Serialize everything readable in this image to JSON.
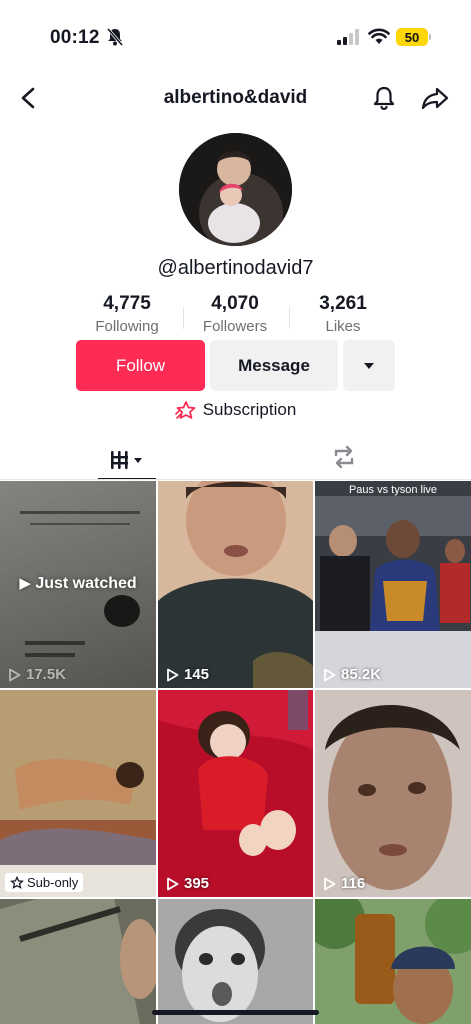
{
  "status": {
    "time": "00:12",
    "battery": "50"
  },
  "header": {
    "title": "albertino&david"
  },
  "profile": {
    "username": "@albertinodavid7",
    "stats": [
      {
        "value": "4,775",
        "label": "Following"
      },
      {
        "value": "4,070",
        "label": "Followers"
      },
      {
        "value": "3,261",
        "label": "Likes"
      }
    ]
  },
  "actions": {
    "follow": "Follow",
    "message": "Message",
    "subscription": "Subscription"
  },
  "grid": {
    "items": [
      {
        "views": "17.5K",
        "overlay": "Just watched"
      },
      {
        "views": "145"
      },
      {
        "views": "85.2K",
        "caption": "Paus vs tyson live"
      },
      {
        "badge": "Sub-only"
      },
      {
        "views": "395"
      },
      {
        "views": "116"
      }
    ]
  },
  "colors": {
    "accent": "#fe2c55",
    "battery": "#ffd60a"
  }
}
